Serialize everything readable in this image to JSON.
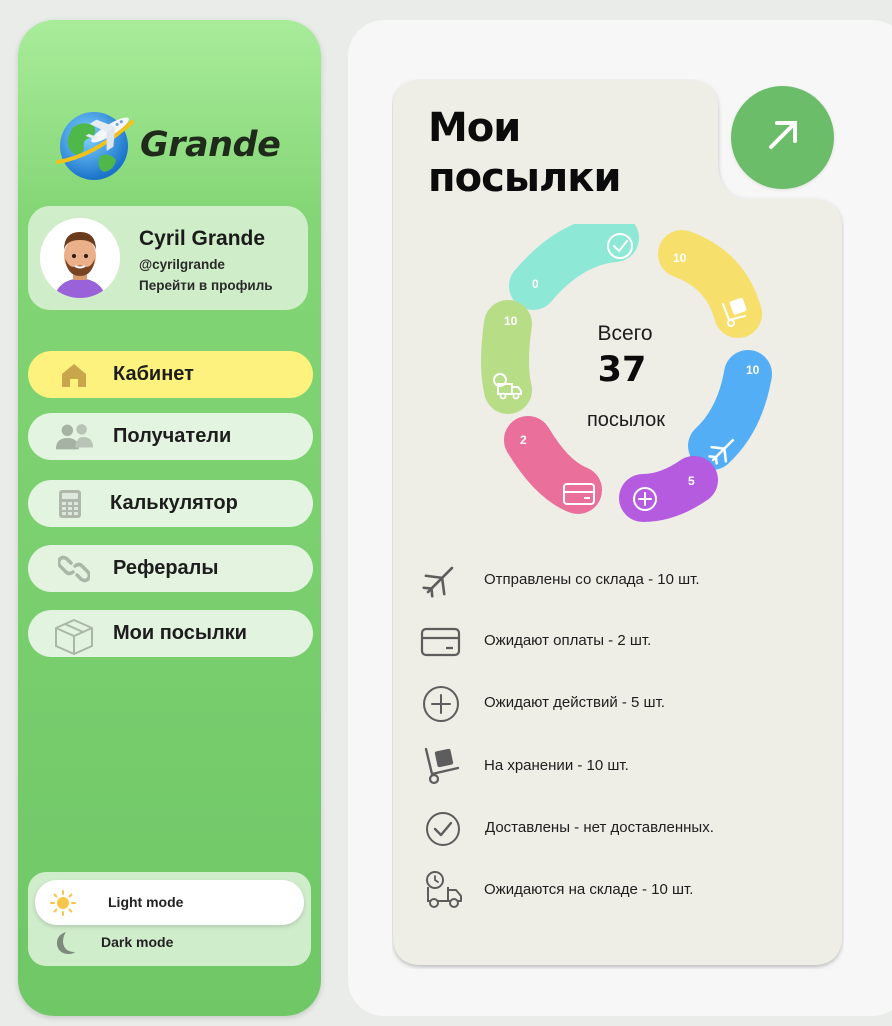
{
  "brand": {
    "name": "Grande"
  },
  "profile": {
    "name": "Cyril Grande",
    "handle": "@cyrilgrande",
    "link": "Перейти в профиль"
  },
  "nav": {
    "items": [
      {
        "label": "Кабинет",
        "icon": "home-icon",
        "active": true
      },
      {
        "label": "Получатели",
        "icon": "users-icon",
        "active": false
      },
      {
        "label": "Калькулятор",
        "icon": "calculator-icon",
        "active": false
      },
      {
        "label": "Рефералы",
        "icon": "link-icon",
        "active": false
      },
      {
        "label": "Мои посылки",
        "icon": "box-icon",
        "active": false
      }
    ]
  },
  "theme": {
    "light": "Light mode",
    "dark": "Dark mode",
    "selected": "light"
  },
  "parcels": {
    "title_line1": "Мои",
    "title_line2": "посылки",
    "total_label_top": "Всего",
    "total": "37",
    "total_label_bottom": "посылок",
    "segments": [
      {
        "value": "0",
        "status": "delivered",
        "color": "#8ee8d6"
      },
      {
        "value": "10",
        "status": "stored",
        "color": "#f7df6c"
      },
      {
        "value": "10",
        "status": "shipped",
        "color": "#54aef6"
      },
      {
        "value": "5",
        "status": "awaiting-action",
        "color": "#b55be0"
      },
      {
        "value": "2",
        "status": "awaiting-payment",
        "color": "#ea6f9b"
      },
      {
        "value": "10",
        "status": "expected",
        "color": "#b7dd87"
      }
    ],
    "legend": [
      {
        "icon": "plane-icon",
        "text": "Отправлены со склада - 10 шт."
      },
      {
        "icon": "card-icon",
        "text": "Ожидают оплаты - 2 шт."
      },
      {
        "icon": "plus-circle-icon",
        "text": "Ожидают действий - 5 шт."
      },
      {
        "icon": "hand-truck-icon",
        "text": "На хранении - 10 шт."
      },
      {
        "icon": "check-circle-icon",
        "text": "Доставлены - нет доставленных."
      },
      {
        "icon": "truck-clock-icon",
        "text": "Ожидаются на складе - 10 шт."
      }
    ]
  }
}
